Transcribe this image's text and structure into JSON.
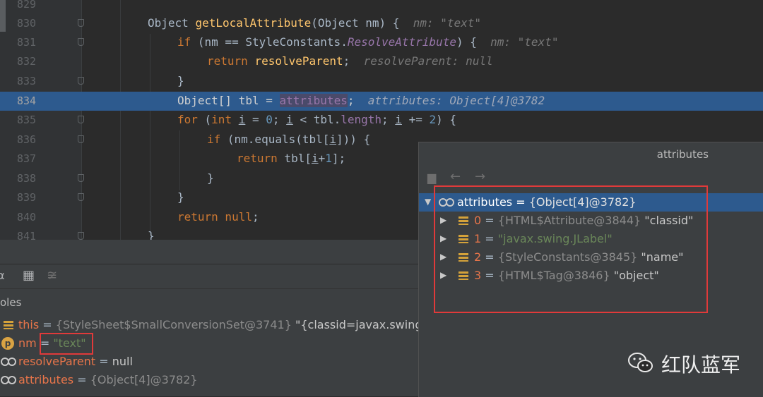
{
  "editor": {
    "lines": [
      {
        "num": "829"
      },
      {
        "num": "830"
      },
      {
        "num": "831"
      },
      {
        "num": "832"
      },
      {
        "num": "833"
      },
      {
        "num": "834"
      },
      {
        "num": "835"
      },
      {
        "num": "836"
      },
      {
        "num": "837"
      },
      {
        "num": "838"
      },
      {
        "num": "839"
      },
      {
        "num": "840"
      },
      {
        "num": "841"
      }
    ],
    "code": {
      "l830": {
        "t1": "Object ",
        "fn": "getLocalAttribute",
        "t2": "(Object nm) {",
        "hint": "nm: \"text\""
      },
      "l831": {
        "kw": "if",
        "t1": " (nm == StyleConstants.",
        "it": "ResolveAttribute",
        "t2": ") {",
        "hint": "nm: \"text\""
      },
      "l832": {
        "kw": "return ",
        "fn": "resolveParent",
        "t1": ";",
        "hint": "resolveParent: null"
      },
      "l833": {
        "t1": "}"
      },
      "l834": {
        "t1": "Object[] tbl = ",
        "field": "attributes",
        "t2": ";",
        "hint": "attributes: Object[4]@3782"
      },
      "l835": {
        "kw1": "for",
        "t1": " (",
        "kw2": "int",
        "t2": " ",
        "v1": "i",
        "t3": " = ",
        "n1": "0",
        "t4": "; ",
        "v2": "i",
        "t5": " < tbl.",
        "field": "length",
        "t6": "; ",
        "v3": "i",
        "t7": " += ",
        "n2": "2",
        "t8": ") {"
      },
      "l836": {
        "kw": "if",
        "t1": " (nm.equals(tbl[",
        "v1": "i",
        "t2": "])) {"
      },
      "l837": {
        "kw": "return",
        "t1": " tbl[",
        "v1": "i",
        "t2": "+",
        "n1": "1",
        "t3": "];"
      },
      "l838": {
        "t1": "}"
      },
      "l839": {
        "t1": "}"
      },
      "l840": {
        "kw": "return null",
        "t1": ";"
      },
      "l841": {
        "t1": "}"
      }
    }
  },
  "variables": {
    "panel_label": "oles",
    "rows": [
      {
        "icon": "field-icon",
        "name": "this",
        "eq": " = ",
        "type": "{StyleSheet$SmallConversionSet@3741}",
        "value": " \"{classid=javax.swing.JLabel,"
      },
      {
        "icon": "param-icon",
        "icon_letter": "p",
        "name": "nm",
        "eq": " = ",
        "value_str": "\"text\""
      },
      {
        "icon": "watch-icon",
        "name": "resolveParent",
        "eq": " = ",
        "value": "null"
      },
      {
        "icon": "watch-icon",
        "name": "attributes",
        "eq": " = ",
        "type": "{Object[4]@3782}"
      }
    ]
  },
  "popup": {
    "title": "attributes",
    "root": {
      "name": "attributes",
      "eq": " = ",
      "type": "{Object[4]@3782}"
    },
    "items": [
      {
        "index": "0",
        "eq": " = ",
        "type": "{HTML$Attribute@3844}",
        "value": " \"classid\""
      },
      {
        "index": "1",
        "eq": " = ",
        "value_str": "\"javax.swing.JLabel\""
      },
      {
        "index": "2",
        "eq": " = ",
        "type": "{StyleConstants@3845}",
        "value": " \"name\""
      },
      {
        "index": "3",
        "eq": " = ",
        "type": "{HTML$Tag@3846}",
        "value": " \"object\""
      }
    ]
  },
  "watermark": {
    "text": "红队蓝军",
    "logo": "wechat-icon"
  },
  "colors": {
    "highlight": "#2d5a8e",
    "annotation": "#e03a3a"
  }
}
